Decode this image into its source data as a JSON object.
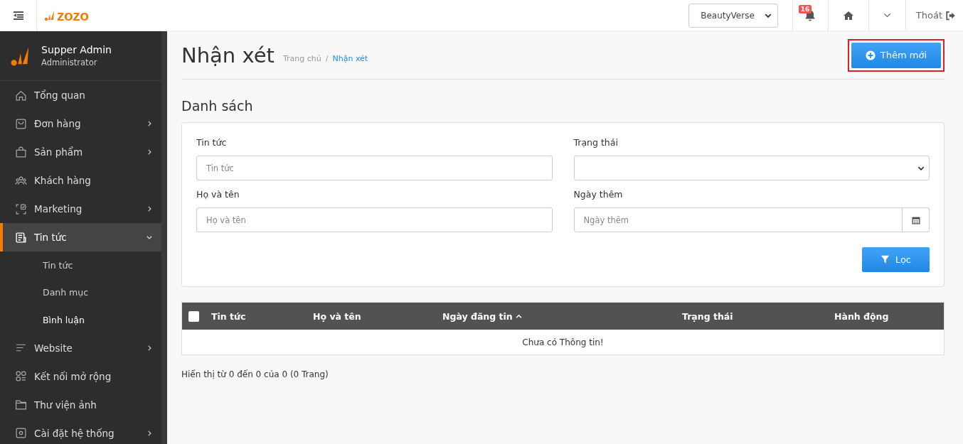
{
  "header": {
    "logo": "zozo",
    "store_select": {
      "value": "BeautyVerse"
    },
    "notifications": {
      "count": "16"
    },
    "logout": "Thoát"
  },
  "sidebar": {
    "user": {
      "name": "Supper Admin",
      "role": "Administrator"
    },
    "items": [
      {
        "label": "Tổng quan",
        "selected": false
      },
      {
        "label": "Đơn hàng",
        "expanded": false,
        "selected": false
      },
      {
        "label": "Sản phẩm",
        "expanded": false,
        "selected": false
      },
      {
        "label": "Khách hàng",
        "selected": false
      },
      {
        "label": "Marketing",
        "expanded": false,
        "selected": false
      },
      {
        "label": "Tin tức",
        "expanded": true,
        "selected": true,
        "children": [
          {
            "label": "Tin tức",
            "selected": false
          },
          {
            "label": "Danh mục",
            "selected": false
          },
          {
            "label": "Bình luận",
            "selected": true
          }
        ]
      },
      {
        "label": "Website",
        "expanded": false,
        "selected": false
      },
      {
        "label": "Kết nối mở rộng",
        "selected": false
      },
      {
        "label": "Thư viện ảnh",
        "selected": false
      },
      {
        "label": "Cài đặt hệ thống",
        "expanded": false,
        "selected": false
      }
    ]
  },
  "page": {
    "title": "Nhận xét",
    "breadcrumb_separator": "/",
    "breadcrumb": [
      {
        "label": "Trang chủ",
        "selected": false
      },
      {
        "label": "Nhận xét",
        "selected": true
      }
    ],
    "add_button": {
      "label": "Thêm mới",
      "highlighted": true
    }
  },
  "section_title": "Danh sách",
  "filters": {
    "fields": [
      {
        "kind": "text",
        "label": "Tin tức",
        "placeholder": "Tin tức"
      },
      {
        "kind": "select",
        "label": "Trạng thái"
      },
      {
        "kind": "text",
        "label": "Họ và tên",
        "placeholder": "Họ và tên"
      },
      {
        "kind": "date",
        "label": "Ngày thêm",
        "placeholder": "Ngày thêm"
      }
    ],
    "button": "Lọc"
  },
  "table": {
    "select_all": {
      "checked": false
    },
    "columns": [
      {
        "label": "Tin tức",
        "sorted": false
      },
      {
        "label": "Họ và tên",
        "sorted": false
      },
      {
        "label": "Ngày đăng tin",
        "sorted": true
      },
      {
        "label": "Trạng thái",
        "sorted": false
      },
      {
        "label": "Hành động",
        "sorted": false
      }
    ],
    "empty_message": "Chưa có Thông tin!"
  },
  "pagination_info": "Hiển thị từ 0 đến 0 của 0 (0 Trang)"
}
